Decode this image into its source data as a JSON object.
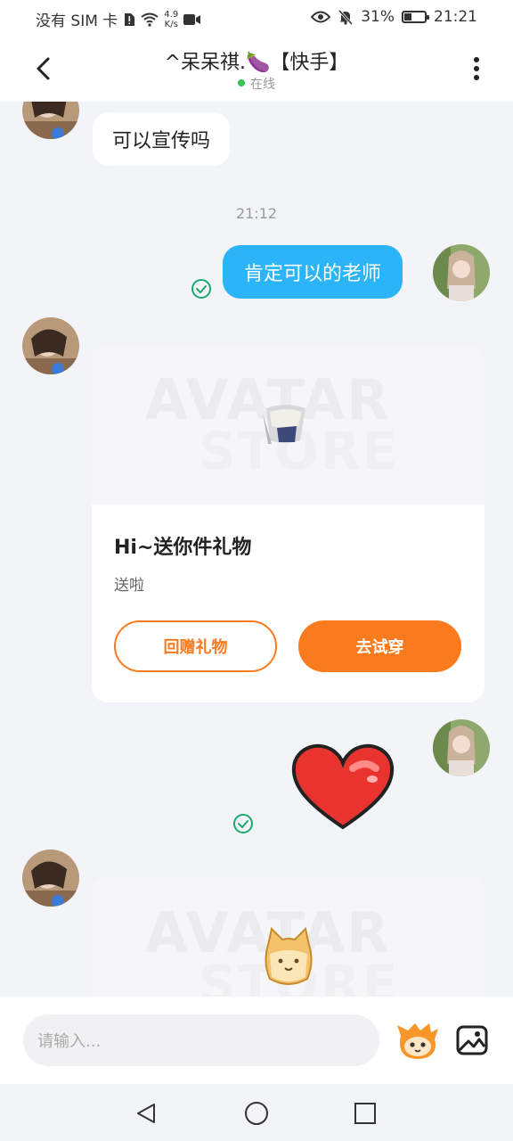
{
  "status_bar": {
    "carrier": "没有 SIM 卡",
    "net_speed_value": "4.9",
    "net_speed_unit": "K/s",
    "battery": "31%",
    "time": "21:21"
  },
  "header": {
    "title": "^呆呆祺.🍆【快手】",
    "status": "在线"
  },
  "messages": {
    "top_text": "可以宣传吗",
    "timestamp": "21:12",
    "sent_text": "肯定可以的老师",
    "gift_card": {
      "watermark_top": "AVATAR",
      "watermark_bottom": "STORE",
      "title": "Hi~送你件礼物",
      "subtitle": "送啦",
      "return_button": "回赠礼物",
      "try_button": "去试穿"
    },
    "card2_watermark_top": "AVATAR",
    "card2_watermark_bottom": "STORE"
  },
  "input": {
    "placeholder": "请输入..."
  },
  "colors": {
    "sent_bubble": "#2bb4f7",
    "accent_orange": "#fa7a1e",
    "check_green": "#1aab6c",
    "online_dot": "#38c25a"
  }
}
